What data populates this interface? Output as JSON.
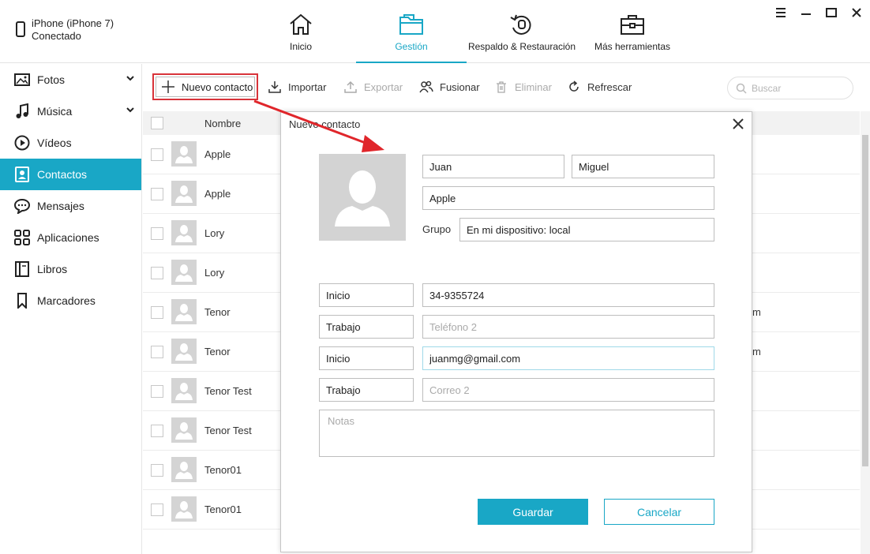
{
  "device": {
    "name": "iPhone (iPhone 7)",
    "status": "Conectado"
  },
  "nav": [
    {
      "label": "Inicio",
      "icon": "home-icon"
    },
    {
      "label": "Gestión",
      "icon": "folder-icon",
      "active": true
    },
    {
      "label": "Respaldo & Restauración",
      "icon": "backup-restore-icon"
    },
    {
      "label": "Más herramientas",
      "icon": "toolbox-icon"
    }
  ],
  "sidebar": {
    "items": [
      {
        "label": "Fotos",
        "icon": "photos-icon",
        "expandable": true
      },
      {
        "label": "Música",
        "icon": "music-icon",
        "expandable": true
      },
      {
        "label": "Vídeos",
        "icon": "video-icon"
      },
      {
        "label": "Contactos",
        "icon": "contacts-icon",
        "active": true
      },
      {
        "label": "Mensajes",
        "icon": "messages-icon"
      },
      {
        "label": "Aplicaciones",
        "icon": "apps-icon"
      },
      {
        "label": "Libros",
        "icon": "books-icon"
      },
      {
        "label": "Marcadores",
        "icon": "bookmark-icon"
      }
    ]
  },
  "toolbar": {
    "new_contact": "Nuevo contacto",
    "import": "Importar",
    "export": "Exportar",
    "merge": "Fusionar",
    "delete": "Eliminar",
    "refresh": "Refrescar",
    "search_placeholder": "Buscar"
  },
  "list": {
    "header": "Nombre",
    "rows": [
      {
        "name": "Apple",
        "extra": ""
      },
      {
        "name": "Apple",
        "extra": ""
      },
      {
        "name": "Lory",
        "extra": ""
      },
      {
        "name": "Lory",
        "extra": ""
      },
      {
        "name": "Tenor",
        "extra": "m"
      },
      {
        "name": "Tenor",
        "extra": "m"
      },
      {
        "name": "Tenor Test",
        "extra": ""
      },
      {
        "name": "Tenor Test",
        "extra": ""
      },
      {
        "name": "Tenor01",
        "extra": ""
      },
      {
        "name": "Tenor01",
        "extra": ""
      }
    ]
  },
  "modal": {
    "title": "Nuevo contacto",
    "first_name": "Juan",
    "last_name": "Miguel",
    "company": "Apple",
    "group_label": "Grupo",
    "group_value": "En mi dispositivo: local",
    "phone1_type": "Inicio",
    "phone1_value": "34-9355724",
    "phone2_type": "Trabajo",
    "phone2_placeholder": "Teléfono 2",
    "email1_type": "Inicio",
    "email1_value": "juanmg@gmail.com",
    "email2_type": "Trabajo",
    "email2_placeholder": "Correo 2",
    "notes_placeholder": "Notas",
    "save": "Guardar",
    "cancel": "Cancelar"
  },
  "colors": {
    "accent": "#19a7c6",
    "highlight": "#d8333a"
  }
}
